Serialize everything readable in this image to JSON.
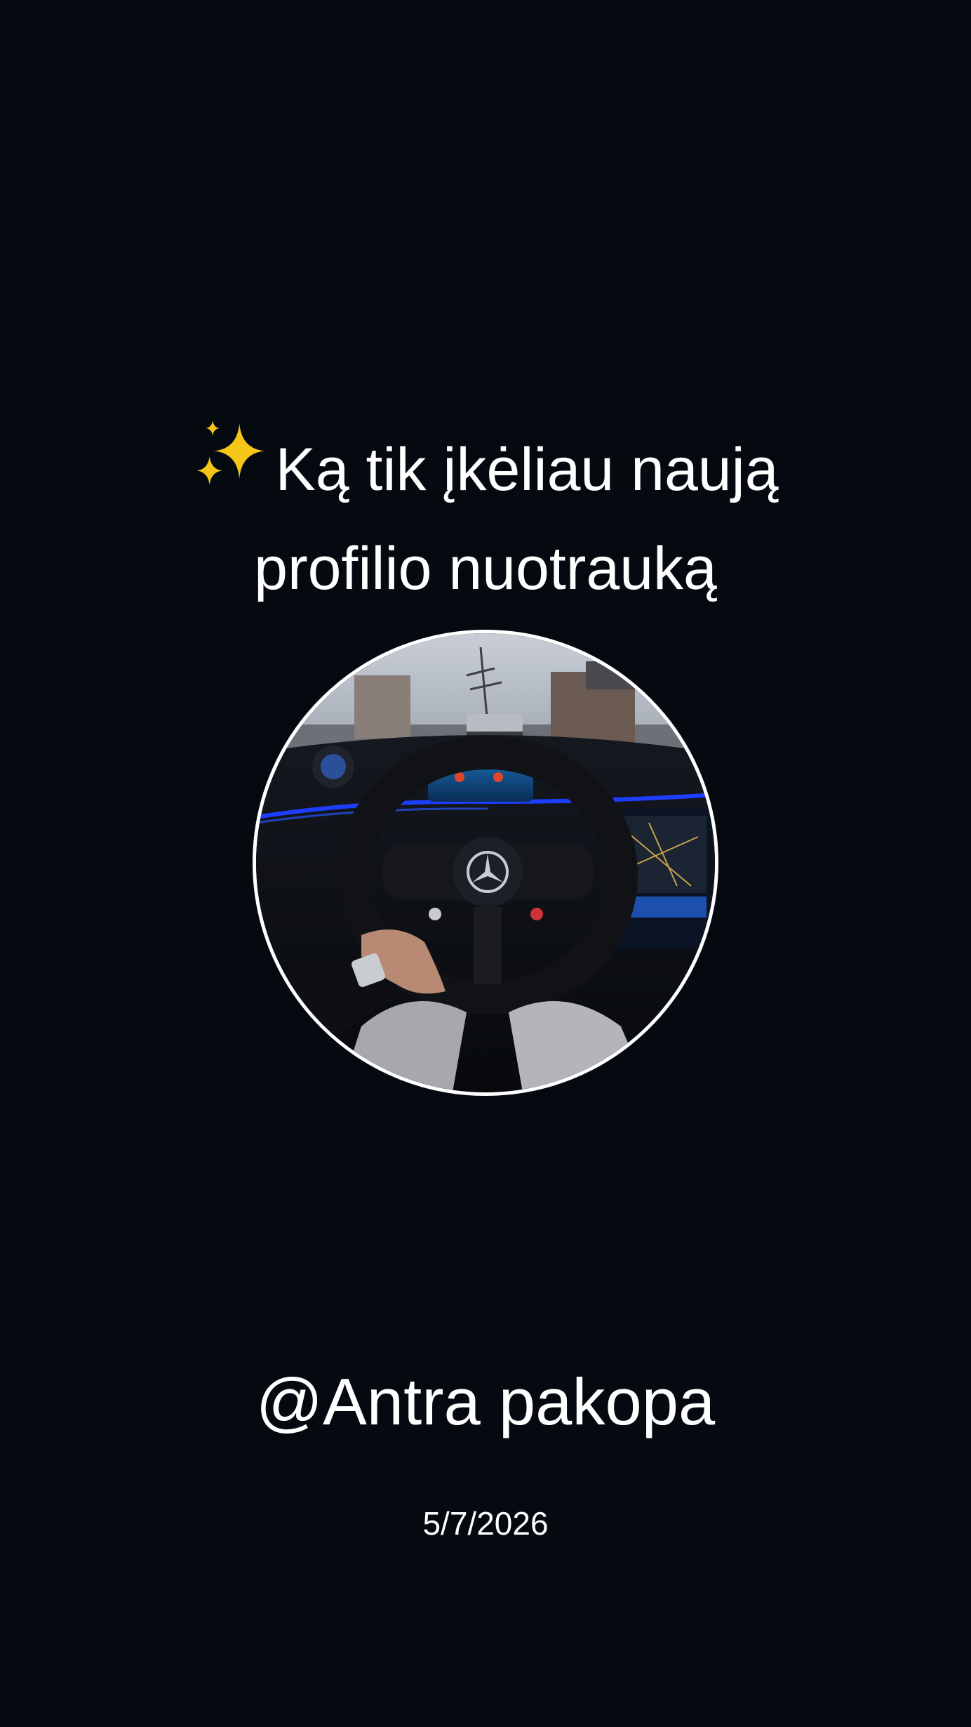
{
  "post": {
    "sparkle_icon": "sparkles-icon",
    "headline_line1": "Ką tik įkėliau naują",
    "headline_line2": "profilio nuotrauką",
    "handle": "@Antra pakopa",
    "date": "5/7/2026"
  },
  "colors": {
    "background": "#050a11",
    "text": "#ffffff",
    "avatar_border": "#ffffff",
    "sparkle": "#f5c518",
    "ambient_light": "#1e3dff"
  }
}
